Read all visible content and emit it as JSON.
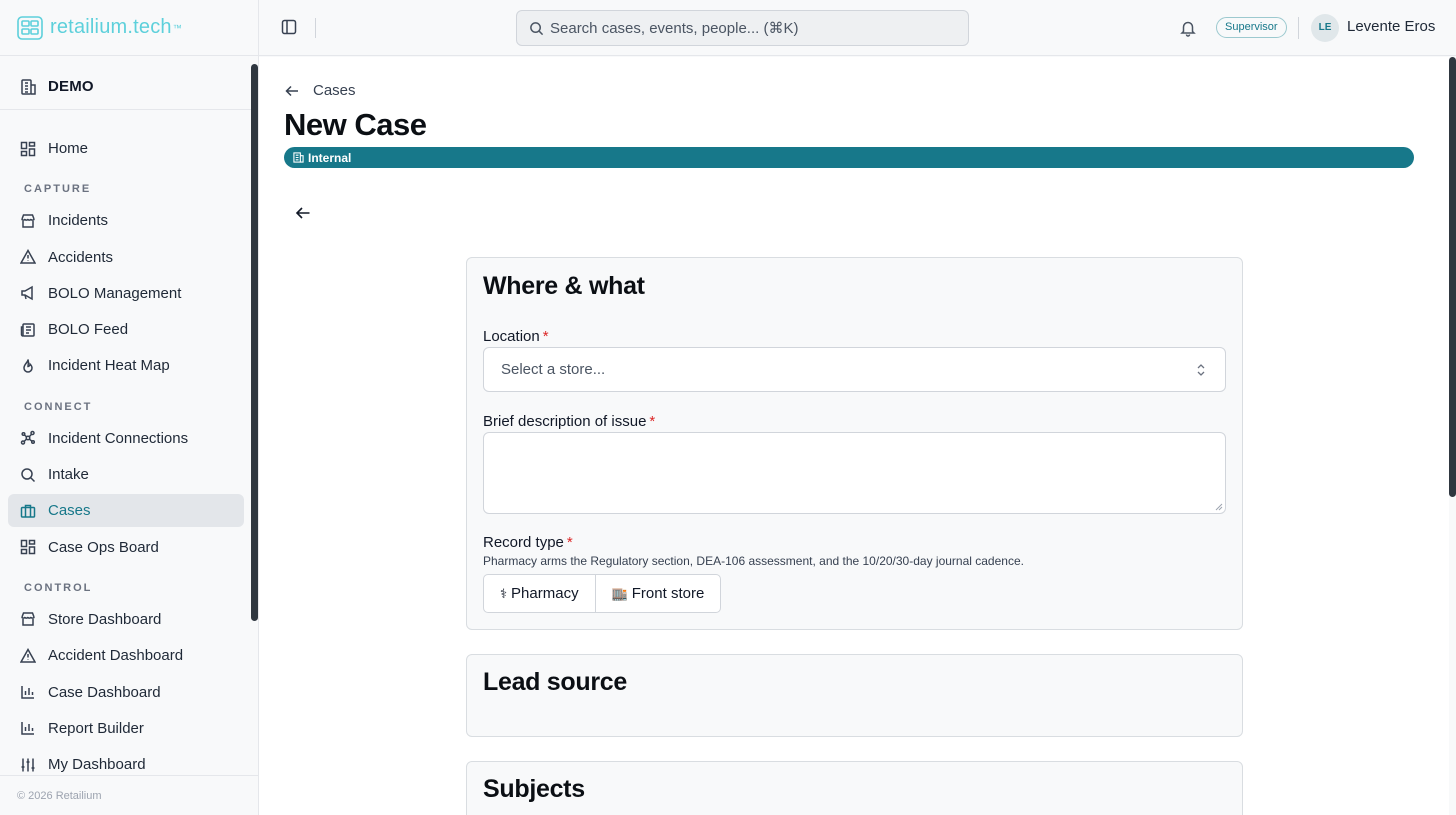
{
  "brand": {
    "name": "retailium.tech",
    "tm": "™"
  },
  "org": {
    "name": "DEMO"
  },
  "nav": {
    "home": "Home",
    "section_capture": "CAPTURE",
    "incidents": "Incidents",
    "accidents": "Accidents",
    "bolo_management": "BOLO Management",
    "bolo_feed": "BOLO Feed",
    "incident_heat_map": "Incident Heat Map",
    "section_connect": "CONNECT",
    "incident_connections": "Incident Connections",
    "intake": "Intake",
    "cases": "Cases",
    "case_ops_board": "Case Ops Board",
    "section_control": "CONTROL",
    "store_dashboard": "Store Dashboard",
    "accident_dashboard": "Accident Dashboard",
    "case_dashboard": "Case Dashboard",
    "report_builder": "Report Builder",
    "my_dashboard": "My Dashboard",
    "active": "cases"
  },
  "footer": "© 2026 Retailium",
  "topbar": {
    "search_placeholder": "Search cases, events, people... (⌘K)",
    "role": "Supervisor",
    "avatar_initials": "LE",
    "user_name": "Levente Eros"
  },
  "page": {
    "breadcrumb": "Cases",
    "title": "New Case",
    "visibility": "Internal"
  },
  "form": {
    "where_what": {
      "title": "Where & what",
      "location_label": "Location",
      "location_placeholder": "Select a store...",
      "description_label": "Brief description of issue",
      "description_value": "",
      "record_type_label": "Record type",
      "record_type_help": "Pharmacy arms the Regulatory section, DEA-106 assessment, and the 10/20/30-day journal cadence.",
      "options": [
        {
          "glyph": "⚕",
          "label": "Pharmacy"
        },
        {
          "glyph": "🏬",
          "label": "Front store"
        }
      ],
      "required_mark": "*"
    },
    "lead_source": {
      "title": "Lead source"
    },
    "subjects": {
      "title": "Subjects"
    }
  },
  "colors": {
    "accent": "#17788a",
    "brand": "#5dd0db",
    "required": "#dc2626"
  }
}
